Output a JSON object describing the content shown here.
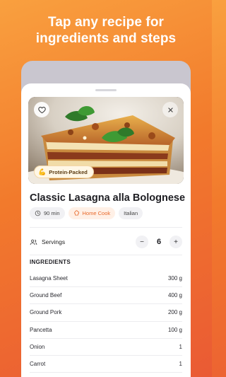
{
  "headline": {
    "line1": "Tap any recipe for",
    "line2": "ingredients and steps"
  },
  "recipe": {
    "badge": "Protein-Packed",
    "title": "Classic Lasagna alla Bolognese",
    "chips": [
      {
        "icon": "clock-icon",
        "label": "90 min"
      },
      {
        "icon": "chef-hat-icon",
        "label": "Home Cook"
      },
      {
        "label": "Italian"
      }
    ]
  },
  "servings": {
    "label": "Servings",
    "count": "6",
    "minus": "−",
    "plus": "+"
  },
  "ingredients": {
    "heading": "INGREDIENTS",
    "items": [
      {
        "name": "Lasagna Sheet",
        "amount": "300 g"
      },
      {
        "name": "Ground Beef",
        "amount": "400 g"
      },
      {
        "name": "Ground Pork",
        "amount": "200 g"
      },
      {
        "name": "Pancetta",
        "amount": "100 g"
      },
      {
        "name": "Onion",
        "amount": "1"
      },
      {
        "name": "Carrot",
        "amount": "1"
      }
    ]
  },
  "colors": {
    "accent": "#e8692a",
    "gradient_start": "#f9a03f",
    "gradient_end": "#ea5a34"
  }
}
